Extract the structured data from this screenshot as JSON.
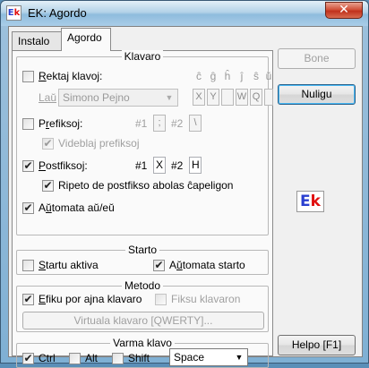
{
  "window": {
    "title": "EK: Agordo",
    "close_glyph": "✕",
    "logo_e": "E",
    "logo_k": "k"
  },
  "tabs": [
    {
      "label": "Instalo",
      "active": false
    },
    {
      "label": "Agordo",
      "active": true
    }
  ],
  "klavaro": {
    "title": "Klavaro",
    "rektaj_pre": "",
    "rektaj_u": "R",
    "rektaj_post": "ektaj klavoj:",
    "letters": [
      "ĉ",
      "ĝ",
      "ĥ",
      "ĵ",
      "ŝ",
      "ŭ"
    ],
    "letter_values": [
      "X",
      "Y",
      "",
      "W",
      "Q",
      ""
    ],
    "lau_label": "Laŭ",
    "layout_value": "Simono Pejno",
    "prefiksoj_pre": "P",
    "prefiksoj_u": "r",
    "prefiksoj_post": "efiksoj:",
    "pref1_label": "#1",
    "pref1_value": ";",
    "pref2_label": "#2",
    "pref2_value": "\\",
    "videblaj_label": "Videblaj prefiksoj",
    "postfiksoj_pre": "",
    "postfiksoj_u": "P",
    "postfiksoj_post": "ostfiksoj:",
    "post1_label": "#1",
    "post1_value": "X",
    "post2_label": "#2",
    "post2_value": "H",
    "ripeto_label": "Ripeto de postfikso abolas ĉapeligon",
    "automata_pre": "A",
    "automata_u": "ŭ",
    "automata_post": "tomata aŭ/eŭ"
  },
  "starto": {
    "title": "Starto",
    "startu_pre": "",
    "startu_u": "S",
    "startu_post": "tartu aktiva",
    "automata_pre": "A",
    "automata_u": "ŭ",
    "automata_post": "tomata starto"
  },
  "metodo": {
    "title": "Metodo",
    "efiku_pre": "",
    "efiku_u": "E",
    "efiku_post": "fiku por ajna klavaro",
    "fiksu_label": "Fiksu klavaron",
    "virtuala_label": "Virtuala klavaro [QWERTY]..."
  },
  "varma": {
    "title": "Varma klavo",
    "ctrl_label": "Ctrl",
    "alt_label": "Alt",
    "shift_label": "Shift",
    "key_value": "Space"
  },
  "buttons": {
    "bone": "Bone",
    "nuligu": "Nuligu",
    "helpo": "Helpo [F1]"
  },
  "checkmark": "✔",
  "dropdown_arrow": "▼"
}
